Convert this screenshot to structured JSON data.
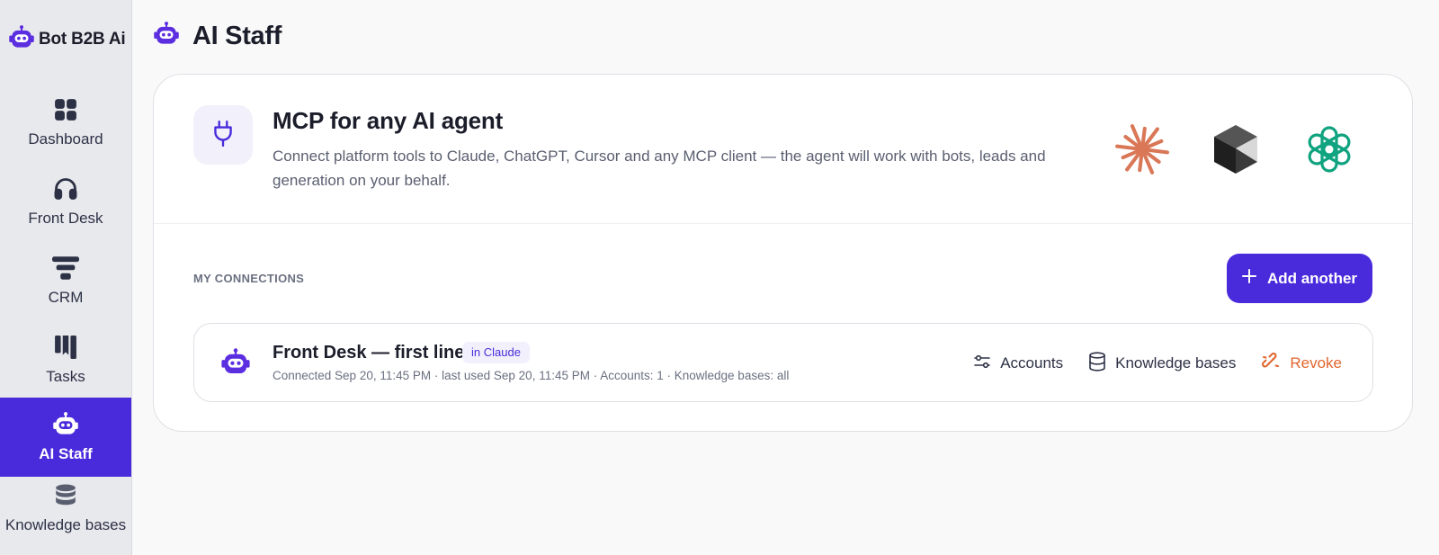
{
  "brand": {
    "name": "Bot B2B Ai",
    "icon": "robot-icon",
    "accent": "#4a2bdc"
  },
  "sidebar": {
    "items": [
      {
        "label": "Dashboard",
        "icon": "grid-icon"
      },
      {
        "label": "Front Desk",
        "icon": "headset-icon"
      },
      {
        "label": "CRM",
        "icon": "funnel-icon"
      },
      {
        "label": "Tasks",
        "icon": "kanban-icon"
      },
      {
        "label": "AI Staff",
        "icon": "robot-icon",
        "active": true
      },
      {
        "label": "Knowledge bases",
        "icon": "database-icon"
      }
    ]
  },
  "header": {
    "title": "AI Staff",
    "icon": "robot-icon"
  },
  "mcp": {
    "title": "MCP for any AI agent",
    "description": "Connect platform tools to Claude, ChatGPT, Cursor and any MCP client — the agent will work with bots, leads and generation on your behalf.",
    "icon": "plug-icon",
    "logos": [
      "claude-logo",
      "cursor-logo",
      "chatgpt-logo"
    ]
  },
  "connections": {
    "header": "MY CONNECTIONS",
    "add_label": "Add another",
    "items": [
      {
        "name": "Front Desk — first line",
        "badge": "in Claude",
        "meta": "Connected Sep 20, 11:45 PM · last used Sep 20, 11:45 PM · Accounts: 1 · Knowledge bases: all",
        "actions": {
          "accounts": "Accounts",
          "knowledge": "Knowledge bases",
          "revoke": "Revoke"
        }
      }
    ]
  },
  "colors": {
    "accent": "#4a2bdc",
    "revoke": "#e0652d",
    "claude": "#d97757",
    "chatgpt": "#10a37f"
  }
}
